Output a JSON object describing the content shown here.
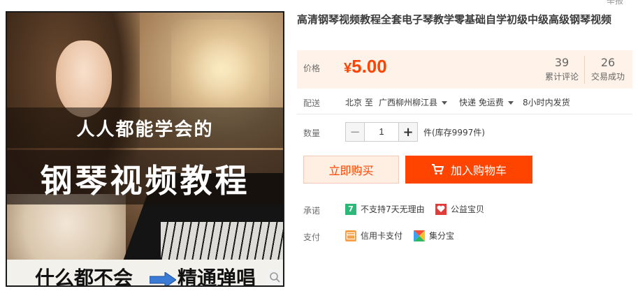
{
  "product": {
    "title": "高清钢琴视频教程全套电子琴教学零基础自学初级中级高级钢琴视频",
    "image": {
      "line1": "人人都能学会的",
      "line2": "钢琴视频教程",
      "line3a": "什么都不会",
      "line3b": "精通弹唱"
    }
  },
  "top_clip": "举报",
  "price_section": {
    "label": "价格",
    "symbol": "¥",
    "value": "5.00",
    "reviews_count": "39",
    "reviews_label": "累计评论",
    "deals_count": "26",
    "deals_label": "交易成功"
  },
  "shipping": {
    "label": "配送",
    "from": "北京 至",
    "to": "广西柳州柳江县",
    "method": "快递 免运费",
    "dispatch": "8小时内发货"
  },
  "quantity": {
    "label": "数量",
    "minus": "−",
    "value": "1",
    "plus": "+",
    "stock": "件(库存9997件)"
  },
  "actions": {
    "buy_now": "立即购买",
    "add_to_cart": "加入购物车"
  },
  "promise": {
    "label": "承诺",
    "item1": "不支持7天无理由",
    "item1_icon_text": "7",
    "item2": "公益宝贝"
  },
  "payment": {
    "label": "支付",
    "item1": "信用卡支付",
    "item2": "集分宝"
  },
  "colors": {
    "accent": "#ff4400",
    "price_bg": "#fff2e8",
    "promise_icon": "#2bb878",
    "charity_icon": "#e03c3c",
    "card_icon": "#f7a14a"
  }
}
